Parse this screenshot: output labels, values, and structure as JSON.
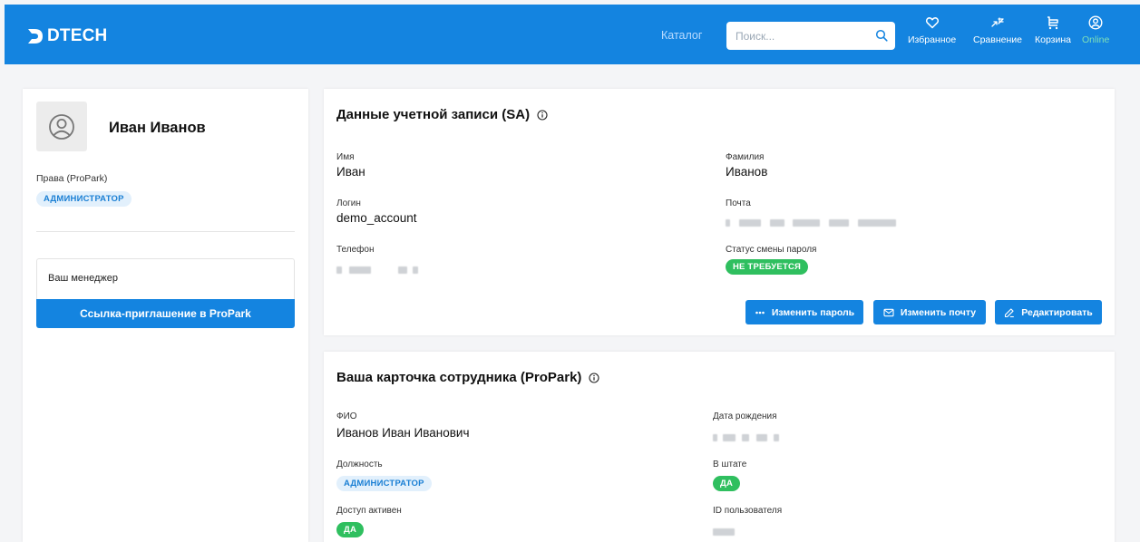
{
  "header": {
    "logo_text": "DTECH",
    "catalog_label": "Каталог",
    "search_placeholder": "Поиск...",
    "nav": {
      "favorites": "Избранное",
      "compare": "Сравнение",
      "cart": "Корзина",
      "online": "Online"
    }
  },
  "profile": {
    "name": "Иван Иванов",
    "rights_label": "Права (ProPark)",
    "rights_badge": "АДМИНИСТРАТОР",
    "manager_label": "Ваш менеджер",
    "invite_button": "Ссылка-приглашение в ProPark"
  },
  "account": {
    "title": "Данные учетной записи (SA)",
    "first_name_label": "Имя",
    "first_name": "Иван",
    "last_name_label": "Фамилия",
    "last_name": "Иванов",
    "login_label": "Логин",
    "login": "demo_account",
    "email_label": "Почта",
    "phone_label": "Телефон",
    "password_status_label": "Статус смены пароля",
    "password_status": "НЕ ТРЕБУЕТСЯ",
    "buttons": {
      "change_password": "Изменить пароль",
      "change_email": "Изменить почту",
      "edit": "Редактировать"
    }
  },
  "employee": {
    "title": "Ваша карточка сотрудника (ProPark)",
    "full_name_label": "ФИО",
    "full_name": "Иванов Иван Иванович",
    "birth_date_label": "Дата рождения",
    "position_label": "Должность",
    "position": "АДМИНИСТРАТОР",
    "staff_label": "В штате",
    "staff": "ДА",
    "access_label": "Доступ активен",
    "access": "ДА",
    "user_id_label": "ID пользователя"
  },
  "colors": {
    "primary": "#1484e0",
    "success": "#2fbf5f",
    "badge_blue_bg": "#e2f0fc",
    "badge_blue_text": "#1a7fd4",
    "online": "#7fe0b8"
  }
}
